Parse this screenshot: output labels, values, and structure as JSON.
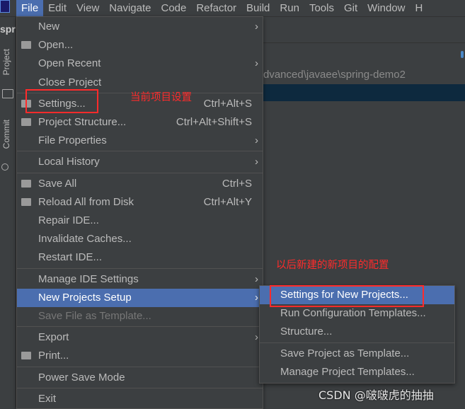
{
  "menubar": {
    "items": [
      {
        "label": "File",
        "mnemonic": 0,
        "active": true
      },
      {
        "label": "Edit",
        "mnemonic": 0
      },
      {
        "label": "View",
        "mnemonic": 0
      },
      {
        "label": "Navigate",
        "mnemonic": 0
      },
      {
        "label": "Code",
        "mnemonic": 0
      },
      {
        "label": "Refactor",
        "mnemonic": 0
      },
      {
        "label": "Build",
        "mnemonic": 0
      },
      {
        "label": "Run",
        "mnemonic": 1
      },
      {
        "label": "Tools",
        "mnemonic": 0
      },
      {
        "label": "Git",
        "mnemonic": 0
      },
      {
        "label": "Window",
        "mnemonic": 0
      },
      {
        "label": "H",
        "mnemonic": 0
      }
    ]
  },
  "tool_strip": {
    "project_tab": "Project",
    "commit_tab": "Commit"
  },
  "project_label": "spr",
  "path_text": "dvanced\\javaee\\spring-demo2",
  "file_menu": {
    "items": [
      {
        "label": "New",
        "mnemonic": 0,
        "submenu": true
      },
      {
        "label": "Open...",
        "mnemonic": 0,
        "icon": "folder-open-icon"
      },
      {
        "label": "Open Recent",
        "mnemonic": 5,
        "submenu": true
      },
      {
        "label": "Close Project"
      },
      {
        "label": "Settings...",
        "mnemonic": 1,
        "shortcut": "Ctrl+Alt+S",
        "icon": "wrench-icon",
        "sep_before": true
      },
      {
        "label": "Project Structure...",
        "shortcut": "Ctrl+Alt+Shift+S",
        "icon": "project-structure-icon"
      },
      {
        "label": "File Properties",
        "submenu": true
      },
      {
        "label": "Local History",
        "mnemonic": 6,
        "submenu": true,
        "sep_before": true
      },
      {
        "label": "Save All",
        "mnemonic": 0,
        "shortcut": "Ctrl+S",
        "icon": "save-icon",
        "sep_before": true
      },
      {
        "label": "Reload All from Disk",
        "shortcut": "Ctrl+Alt+Y",
        "icon": "reload-icon"
      },
      {
        "label": "Repair IDE..."
      },
      {
        "label": "Invalidate Caches..."
      },
      {
        "label": "Restart IDE..."
      },
      {
        "label": "Manage IDE Settings",
        "submenu": true,
        "sep_before": true
      },
      {
        "label": "New Projects Setup",
        "submenu": true,
        "selected": true
      },
      {
        "label": "Save File as Template...",
        "mnemonic": 14,
        "disabled": true
      },
      {
        "label": "Export",
        "submenu": true,
        "sep_before": true
      },
      {
        "label": "Print...",
        "mnemonic": 0,
        "icon": "print-icon"
      },
      {
        "label": "Power Save Mode",
        "sep_before": true
      },
      {
        "label": "Exit",
        "mnemonic": 1,
        "sep_before": true
      }
    ]
  },
  "submenu": {
    "items": [
      {
        "label": "Settings for New Projects...",
        "selected": true
      },
      {
        "label": "Run Configuration Templates..."
      },
      {
        "label": "Structure..."
      },
      {
        "label": "Save Project as Template...",
        "sep_before": true
      },
      {
        "label": "Manage Project Templates..."
      }
    ]
  },
  "annotations": {
    "current_project": "当前项目设置",
    "new_projects": "以后新建的新项目的配置",
    "color": "#ff2b2b"
  },
  "watermark": "CSDN @啵啵虎的抽抽",
  "colors": {
    "selection": "#4b6eaf",
    "background": "#3c3f41"
  }
}
